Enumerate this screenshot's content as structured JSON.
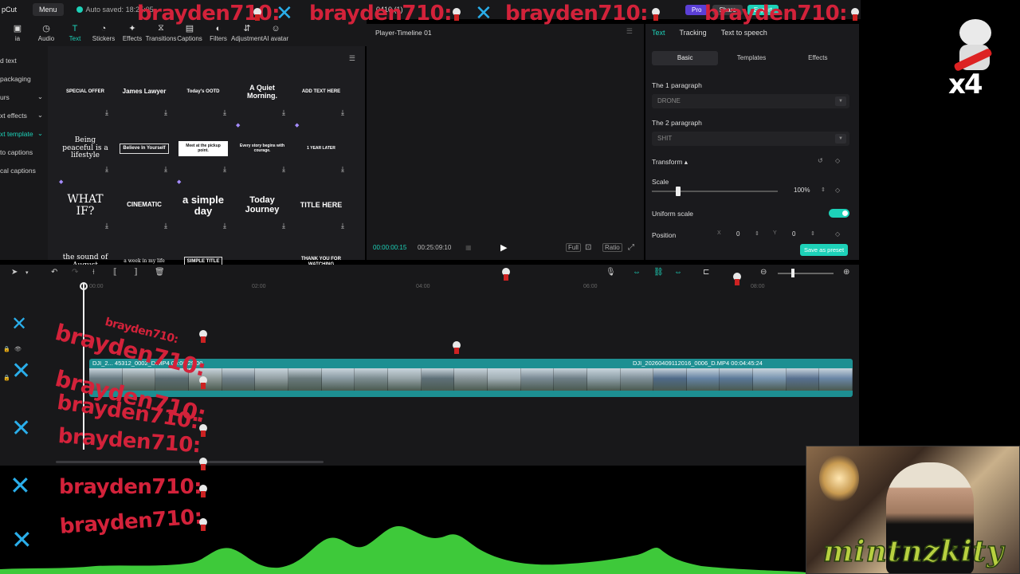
{
  "topbar": {
    "app_name": "pCut",
    "menu_label": "Menu",
    "autosave": "Auto saved: 18:25:05",
    "project_title": "0410 (1)",
    "pro_label": "Pro",
    "share_label": "Share",
    "export_label": "Export"
  },
  "tool_tabs": [
    {
      "label": "ia",
      "icon": "media-icon"
    },
    {
      "label": "Audio",
      "icon": "audio-icon"
    },
    {
      "label": "Text",
      "icon": "text-icon",
      "active": true
    },
    {
      "label": "Stickers",
      "icon": "stickers-icon"
    },
    {
      "label": "Effects",
      "icon": "effects-icon"
    },
    {
      "label": "Transitions",
      "icon": "transitions-icon"
    },
    {
      "label": "Captions",
      "icon": "captions-icon"
    },
    {
      "label": "Filters",
      "icon": "filters-icon"
    },
    {
      "label": "Adjustment",
      "icon": "adjustment-icon"
    },
    {
      "label": "AI avatar",
      "icon": "ai-avatar-icon"
    }
  ],
  "left_menu": [
    {
      "label": "d text"
    },
    {
      "label": "packaging"
    },
    {
      "label": "urs",
      "chevron": true
    },
    {
      "label": "xt effects",
      "chevron": true
    },
    {
      "label": "xt template",
      "chevron": true,
      "active": true
    },
    {
      "label": "to captions"
    },
    {
      "label": "cal captions"
    }
  ],
  "templates": [
    {
      "text": "SPECIAL OFFER",
      "size": 6
    },
    {
      "text": "James Lawyer",
      "size": 8
    },
    {
      "text": "Today's OOTD",
      "size": 6
    },
    {
      "text": "A Quiet Morning.",
      "size": 9
    },
    {
      "text": "ADD TEXT HERE",
      "size": 6
    },
    {
      "text": "Being peaceful is a lifestyle",
      "size": 9
    },
    {
      "text": "Believe In Yourself",
      "size": 6
    },
    {
      "text": "Meet at the pickup point.",
      "size": 5
    },
    {
      "text": "Every story begins with courage.",
      "size": 5
    },
    {
      "text": "1 YEAR LATER",
      "size": 5
    },
    {
      "text": "WHAT IF?",
      "size": 14
    },
    {
      "text": "CINEMATIC",
      "size": 8
    },
    {
      "text": "a simple day",
      "size": 13
    },
    {
      "text": "Today Journey",
      "size": 11
    },
    {
      "text": "TITLE HERE",
      "size": 9
    },
    {
      "text": "the sound of August",
      "size": 9
    },
    {
      "text": "a week in my life",
      "size": 6
    },
    {
      "text": "SIMPLE TITLE",
      "size": 6
    },
    {
      "text": "",
      "size": 6
    },
    {
      "text": "THANK YOU FOR WATCHING",
      "size": 6
    }
  ],
  "player": {
    "title": "Player-Timeline 01",
    "time_current": "00:00:00:15",
    "time_total": "00:25:09:10",
    "full_label": "Full",
    "ratio_label": "Ratio"
  },
  "inspector": {
    "tabs": [
      "Text",
      "Tracking",
      "Text to speech"
    ],
    "subtabs": [
      "Basic",
      "Templates",
      "Effects"
    ],
    "para1_label": "The 1 paragraph",
    "para1_value": "DRONE",
    "para2_label": "The 2 paragraph",
    "para2_value": "SHIT",
    "transform_label": "Transform",
    "scale_label": "Scale",
    "scale_value": "100%",
    "uniform_label": "Uniform scale",
    "position_label": "Position",
    "pos_x_label": "X",
    "pos_x": "0",
    "pos_y_label": "Y",
    "pos_y": "0",
    "save_preset": "Save as preset"
  },
  "ruler": [
    "00:00",
    "02:00",
    "04:00",
    "06:00",
    "08:00"
  ],
  "clips": [
    {
      "label": "DJI_2... 45312_0002_D.MP4   00:06:29:00"
    },
    {
      "label": "DJI_20260409112016_0006_D.MP4   00:04:45:24"
    }
  ],
  "overlay": {
    "name": "brayden710:",
    "x_glyph": "✕",
    "count": "x4"
  },
  "webcam": {
    "watermark": "mintnzkity"
  },
  "colors": {
    "accent": "#1dd1b8",
    "clip": "#1d8f92",
    "overlay_red": "#d3223a",
    "overlay_blue": "#2aaeea",
    "wave_green": "#3ec93a"
  }
}
